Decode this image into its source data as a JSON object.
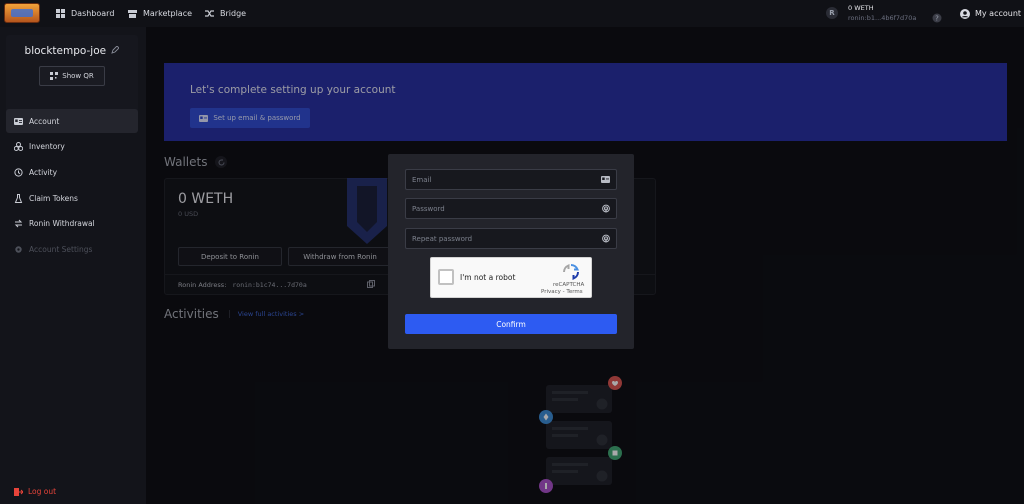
{
  "topbar": {
    "nav": [
      {
        "label": "Dashboard",
        "icon": "grid-icon"
      },
      {
        "label": "Marketplace",
        "icon": "store-icon"
      },
      {
        "label": "Bridge",
        "icon": "shuffle-icon"
      }
    ],
    "balance": "0 WETH",
    "address_short": "ronin:b1...4b6f7d70a",
    "my_account": "My account"
  },
  "sidebar": {
    "username": "blocktempo-joe",
    "show_qr": "Show QR",
    "items": [
      {
        "label": "Account",
        "icon": "id-card-icon"
      },
      {
        "label": "Inventory",
        "icon": "boxes-icon"
      },
      {
        "label": "Activity",
        "icon": "history-icon"
      },
      {
        "label": "Claim Tokens",
        "icon": "flask-icon"
      },
      {
        "label": "Ronin Withdrawal",
        "icon": "swap-icon"
      },
      {
        "label": "Account Settings",
        "icon": "gear-icon"
      }
    ],
    "logout": "Log out"
  },
  "banner": {
    "title": "Let's complete setting up your account",
    "button": "Set up email & password"
  },
  "wallets": {
    "title": "Wallets",
    "balance": "0 WETH",
    "usd": "0 USD",
    "deposit": "Deposit to Ronin",
    "withdraw": "Withdraw from Ronin",
    "address_label": "Ronin Address:",
    "address": "ronin:b1c74...7d70a"
  },
  "activities": {
    "title": "Activities",
    "view_all": "View full activities >"
  },
  "modal": {
    "email_placeholder": "Email",
    "password_placeholder": "Password",
    "repeat_placeholder": "Repeat password",
    "captcha_label": "I'm not a robot",
    "captcha_brand": "reCAPTCHA",
    "captcha_links": "Privacy - Terms",
    "confirm": "Confirm"
  },
  "colors": {
    "banner": "#262da0",
    "primary": "#2d5bf2",
    "danger": "#e8443a"
  }
}
